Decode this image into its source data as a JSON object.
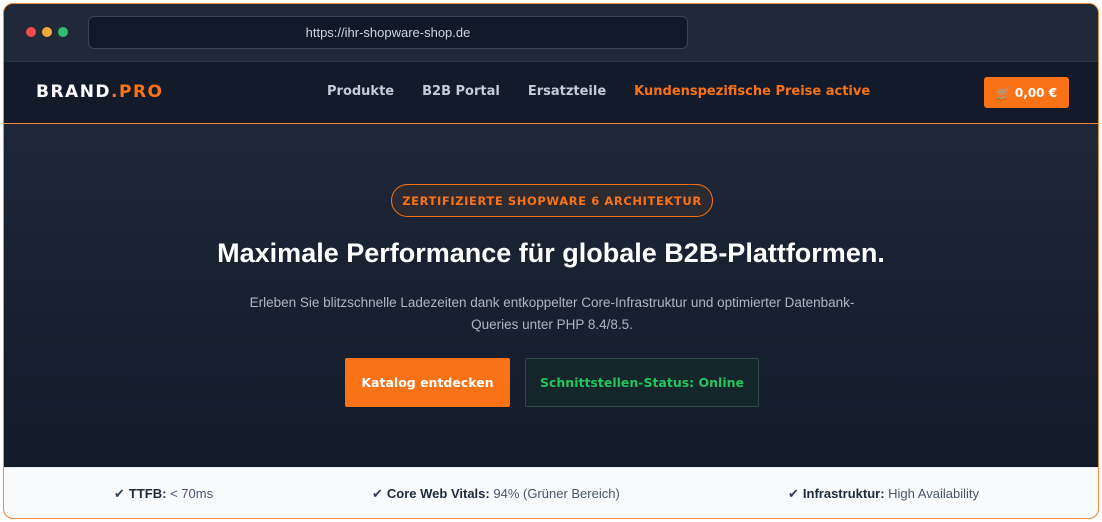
{
  "browser": {
    "url": "https://ihr-shopware-shop.de"
  },
  "nav": {
    "logo_main": "BRAND",
    "logo_accent": ".PRO",
    "links": [
      {
        "label": "Produkte"
      },
      {
        "label": "B2B Portal"
      },
      {
        "label": "Ersatzteile"
      },
      {
        "label": "Kundenspezifische Preise active"
      }
    ],
    "cart_icon": "shopping-cart-icon",
    "cart_total": "0,00 €"
  },
  "hero": {
    "badge": "ZERTIFIZIERTE SHOPWARE 6 ARCHITEKTUR",
    "headline": "Maximale Performance für globale B2B-Plattformen.",
    "subtext": "Erleben Sie blitzschnelle Ladezeiten dank entkoppelter Core-Infrastruktur und optimierter Datenbank-Queries unter PHP 8.4/8.5.",
    "primary_button": "Katalog entdecken",
    "status_button": "Schnittstellen-Status: Online"
  },
  "stats": [
    {
      "label": "TTFB:",
      "value": "< 70ms"
    },
    {
      "label": "Core Web Vitals:",
      "value": "94% (Grüner Bereich)"
    },
    {
      "label": "Infrastruktur:",
      "value": "High Availability"
    }
  ],
  "colors": {
    "accent": "#f97316",
    "status_green": "#22c55e",
    "background": "#1a2233"
  }
}
